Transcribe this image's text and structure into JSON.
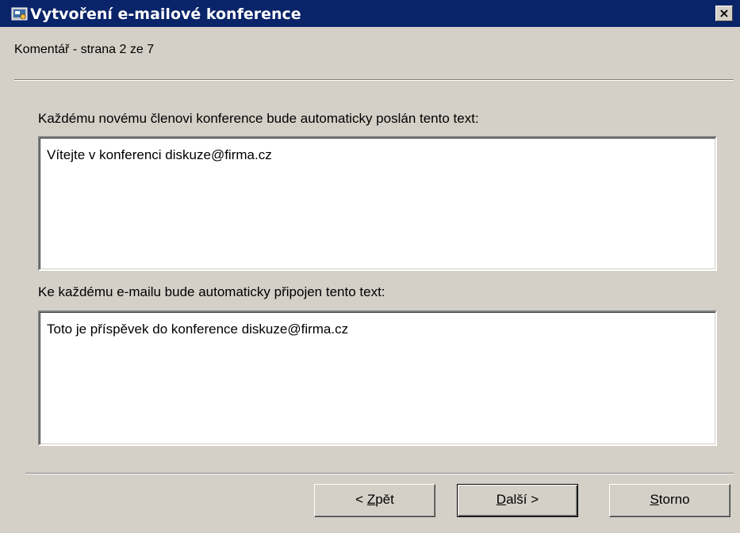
{
  "window": {
    "title": "Vytvoření e-mailové konference",
    "close_label": "×"
  },
  "page": {
    "subtitle": "Komentář - strana 2 ze 7"
  },
  "welcome": {
    "label": "Každému novému členovi konference bude automaticky poslán tento text:",
    "value": "Vítejte v konferenci diskuze@firma.cz"
  },
  "footer_text": {
    "label": "Ke každému e-mailu bude automaticky připojen tento text:",
    "value": "Toto je příspěvek do konference diskuze@firma.cz"
  },
  "buttons": {
    "back": {
      "prefix": "< ",
      "mnemonic": "Z",
      "rest": "pět"
    },
    "next": {
      "mnemonic": "D",
      "rest": "alší >"
    },
    "cancel": {
      "mnemonic": "S",
      "rest": "torno"
    }
  },
  "colors": {
    "titlebar": "#0a246a",
    "dialog_bg": "#d4d0c8"
  }
}
